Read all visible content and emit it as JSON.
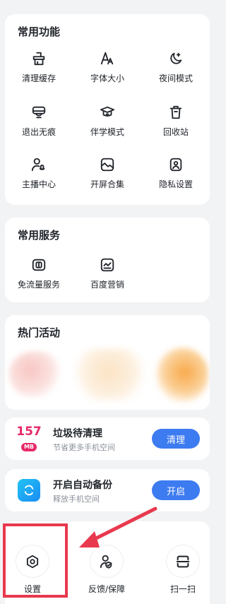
{
  "common_functions": {
    "title": "常用功能",
    "items": [
      {
        "label": "清理缓存",
        "icon": "broom-bucket-icon"
      },
      {
        "label": "字体大小",
        "icon": "font-size-icon"
      },
      {
        "label": "夜间模式",
        "icon": "moon-icon"
      },
      {
        "label": "退出无痕",
        "icon": "incognito-mask-icon"
      },
      {
        "label": "伴学模式",
        "icon": "graduation-cap-icon"
      },
      {
        "label": "回收站",
        "icon": "trash-bin-icon"
      },
      {
        "label": "主播中心",
        "icon": "streamer-mic-icon"
      },
      {
        "label": "开屏合集",
        "icon": "splash-screen-icon"
      },
      {
        "label": "隐私设置",
        "icon": "privacy-shield-icon"
      }
    ]
  },
  "common_services": {
    "title": "常用服务",
    "items": [
      {
        "label": "免流量服务",
        "icon": "data-free-sim-icon"
      },
      {
        "label": "百度营销",
        "icon": "marketing-chart-icon"
      }
    ]
  },
  "hot_activities": {
    "title": "热门活动"
  },
  "cleanup": {
    "size_value": "157",
    "size_unit": "MB",
    "title": "垃圾待清理",
    "subtitle": "节省更多手机空间",
    "button": "清理"
  },
  "backup": {
    "title": "开启自动备份",
    "subtitle": "释放手机空间",
    "button": "开启"
  },
  "bottom_bar": {
    "items": [
      {
        "label": "设置",
        "icon": "settings-gear-icon"
      },
      {
        "label": "反馈/保障",
        "icon": "feedback-shield-icon"
      },
      {
        "label": "扫一扫",
        "icon": "scan-icon"
      }
    ]
  },
  "colors": {
    "accent_blue": "#3d7bf0",
    "storage_pink": "#e8286b",
    "annotation_red": "#e8394e",
    "background": "#f2f3f5"
  }
}
